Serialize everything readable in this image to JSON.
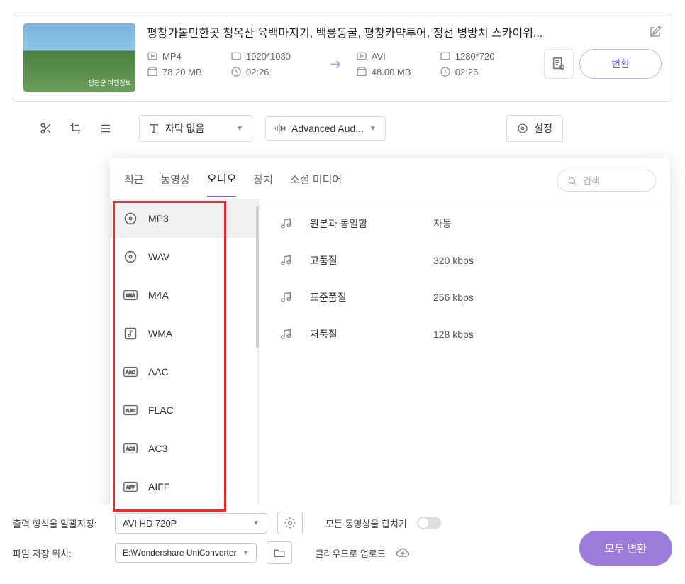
{
  "card": {
    "title": "평창가볼만한곳 청옥산 육백마지기, 백룡동굴, 평창카약투어, 정선 병방치 스카이워...",
    "thumb_text": "평창군 여행정보",
    "source": {
      "format": "MP4",
      "resolution": "1920*1080",
      "size": "78.20 MB",
      "duration": "02:26"
    },
    "target": {
      "format": "AVI",
      "resolution": "1280*720",
      "size": "48.00 MB",
      "duration": "02:26"
    },
    "convert_label": "변환",
    "subtitle_label": "자막 없음",
    "audio_label": "Advanced Aud...",
    "settings_label": "설정"
  },
  "popup": {
    "tabs": [
      "최근",
      "동영상",
      "오디오",
      "장치",
      "소셜 미디어"
    ],
    "active_tab": "오디오",
    "search_placeholder": "검색",
    "formats": [
      "MP3",
      "WAV",
      "M4A",
      "WMA",
      "AAC",
      "FLAC",
      "AC3",
      "AIFF"
    ],
    "qualities": [
      {
        "name": "원본과 동일함",
        "rate": "자동"
      },
      {
        "name": "고품질",
        "rate": "320 kbps"
      },
      {
        "name": "표준품질",
        "rate": "256 kbps"
      },
      {
        "name": "저품질",
        "rate": "128 kbps"
      }
    ]
  },
  "bottom": {
    "output_format_label": "출력 형식을 일괄지정:",
    "output_format_value": "AVI HD 720P",
    "save_path_label": "파일 저장 위치:",
    "save_path_value": "E:\\Wondershare UniConverter",
    "merge_label": "모든 동영상을 합치기",
    "cloud_label": "클라우드로 업로드",
    "convert_all_label": "모두 변환"
  }
}
